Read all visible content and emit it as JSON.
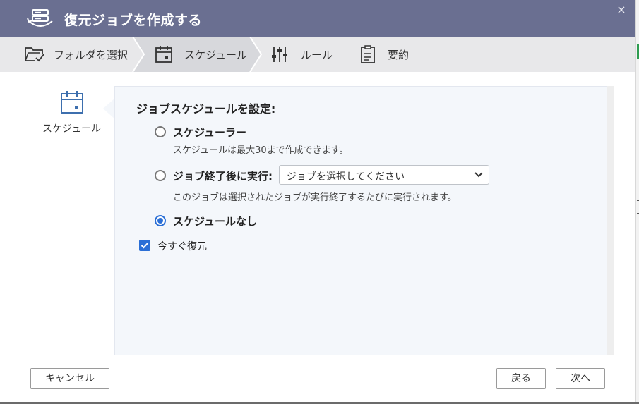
{
  "dialog": {
    "title": "復元ジョブを作成する",
    "close_glyph": "×"
  },
  "steps": [
    {
      "label": "フォルダを選択",
      "icon": "folder-check-icon"
    },
    {
      "label": "スケジュール",
      "icon": "calendar-icon"
    },
    {
      "label": "ルール",
      "icon": "sliders-icon"
    },
    {
      "label": "要約",
      "icon": "clipboard-icon"
    }
  ],
  "leftnav": {
    "label": "スケジュール",
    "icon": "calendar-icon"
  },
  "schedule": {
    "heading": "ジョブスケジュールを設定:",
    "option_scheduler": {
      "label": "スケジューラー",
      "desc": "スケジュールは最大30まで作成できます。",
      "selected": false
    },
    "option_after_job": {
      "label": "ジョブ終了後に実行:",
      "select_value": "ジョブを選択してください",
      "desc": "このジョブは選択されたジョブが実行終了するたびに実行されます。",
      "selected": false
    },
    "option_none": {
      "label": "スケジュールなし",
      "selected": true
    },
    "restore_now": {
      "label": "今すぐ復元",
      "checked": true
    }
  },
  "buttons": {
    "cancel": "キャンセル",
    "back": "戻る",
    "next": "次へ"
  },
  "colors": {
    "titlebar": "#6a6f91",
    "accent": "#2b6fd6",
    "panel": "#f4f7fb",
    "stepsbar": "#e8e8ea"
  }
}
